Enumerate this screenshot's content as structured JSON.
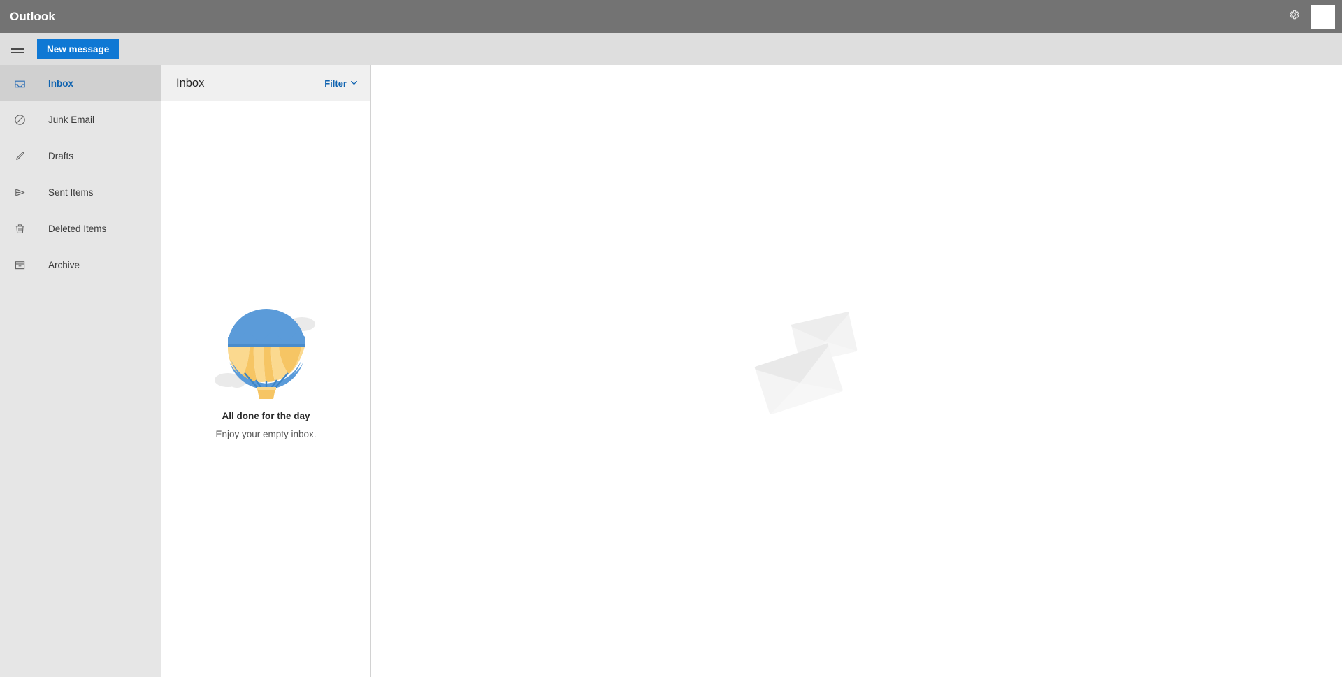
{
  "topbar": {
    "brand": "Outlook",
    "settings_icon": "gear-icon",
    "avatar_icon": "avatar-placeholder",
    "background_color": "#737373"
  },
  "commandbar": {
    "menu_icon": "hamburger-menu-icon",
    "new_message_label": "New message",
    "new_message_color": "#0f78d4",
    "background_color": "#dedede"
  },
  "sidebar": {
    "background_color": "#e6e6e6",
    "selected_color": "#0f63b0",
    "items": [
      {
        "label": "Inbox",
        "icon": "inbox-tray-icon",
        "selected": true
      },
      {
        "label": "Junk Email",
        "icon": "block-circle-slash-icon",
        "selected": false
      },
      {
        "label": "Drafts",
        "icon": "pencil-icon",
        "selected": false
      },
      {
        "label": "Sent Items",
        "icon": "paper-plane-icon",
        "selected": false
      },
      {
        "label": "Deleted Items",
        "icon": "trash-bin-icon",
        "selected": false
      },
      {
        "label": "Archive",
        "icon": "archive-box-icon",
        "selected": false
      }
    ]
  },
  "message_list": {
    "title": "Inbox",
    "filter_label": "Filter",
    "filter_chevron_icon": "chevron-down-icon",
    "header_background": "#f0f0f0",
    "empty_state": {
      "illustration": "hot-air-balloon-icon",
      "title": "All done for the day",
      "subtitle": "Enjoy your empty inbox.",
      "balloon_top_color": "#5b9bd9",
      "balloon_panel_color": "#f6c564",
      "balloon_panel_light_color": "#fbd98f",
      "basket_color": "#f6c564",
      "cloud_color": "#eaeaea"
    }
  },
  "reading_pane": {
    "illustration": "two-envelopes-icon",
    "envelope_color": "#f2f2f2",
    "envelope_shade_color": "#e8e8e8"
  }
}
